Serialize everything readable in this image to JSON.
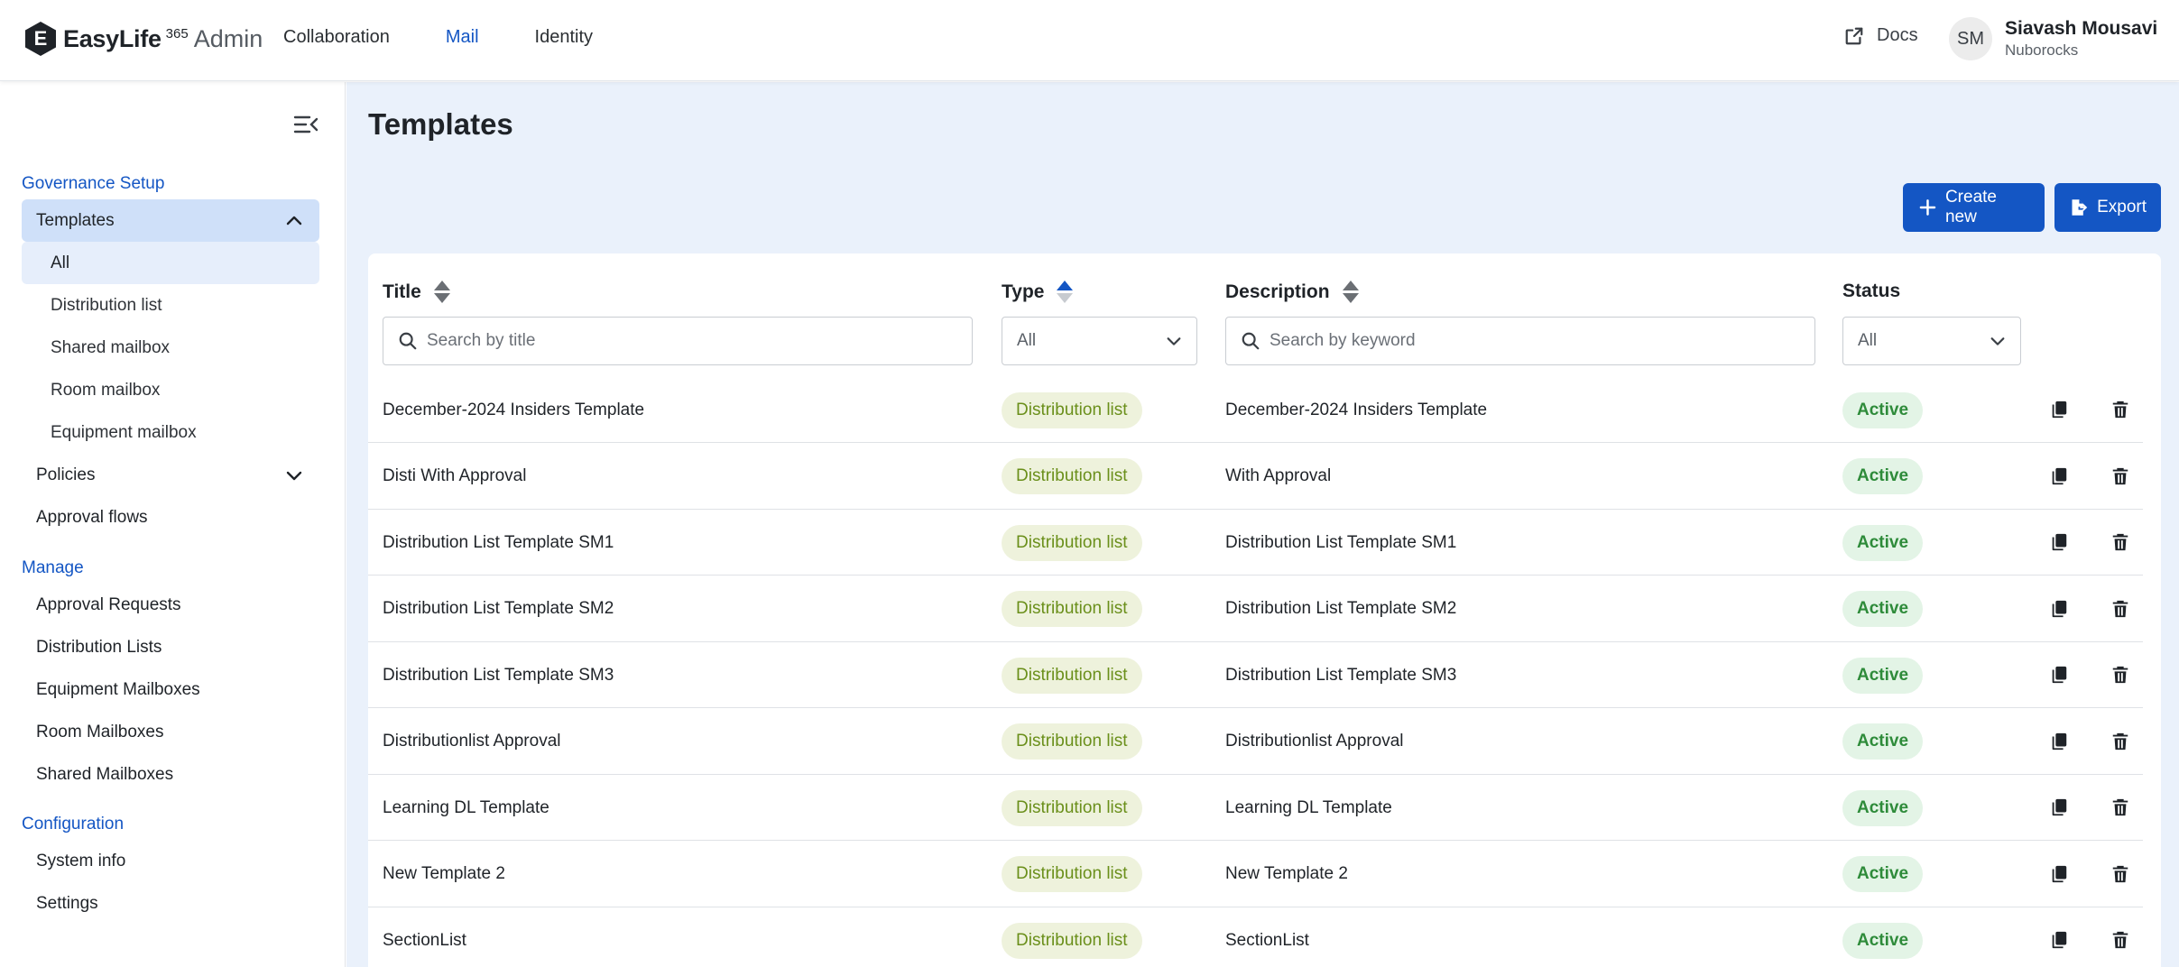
{
  "header": {
    "logo_letter": "E",
    "brand": "EasyLife",
    "brand_superscript": "365",
    "brand_suffix": "Admin",
    "nav": [
      "Collaboration",
      "Mail",
      "Identity"
    ],
    "active_nav": "Mail",
    "docs_label": "Docs",
    "user": {
      "initials": "SM",
      "name": "Siavash Mousavi",
      "org": "Nuborocks"
    }
  },
  "sidebar": {
    "sections": [
      {
        "title": "Governance Setup"
      },
      {
        "title": "Manage"
      },
      {
        "title": "Configuration"
      }
    ],
    "governance": {
      "templates_label": "Templates",
      "template_subitems": [
        "All",
        "Distribution list",
        "Shared mailbox",
        "Room mailbox",
        "Equipment mailbox"
      ],
      "policies_label": "Policies",
      "approval_flows_label": "Approval flows"
    },
    "manage_items": [
      "Approval Requests",
      "Distribution Lists",
      "Equipment Mailboxes",
      "Room Mailboxes",
      "Shared Mailboxes"
    ],
    "configuration_items": [
      "System info",
      "Settings"
    ]
  },
  "page": {
    "title": "Templates",
    "create_label": "Create new",
    "export_label": "Export"
  },
  "table": {
    "columns": {
      "title": "Title",
      "type": "Type",
      "description": "Description",
      "status": "Status"
    },
    "filters": {
      "title_placeholder": "Search by title",
      "type_value": "All",
      "description_placeholder": "Search by keyword",
      "status_value": "All"
    },
    "rows": [
      {
        "title": "December-2024 Insiders Template",
        "type": "Distribution list",
        "description": "December-2024 Insiders Template",
        "status": "Active"
      },
      {
        "title": "Disti With Approval",
        "type": "Distribution list",
        "description": "With Approval",
        "status": "Active"
      },
      {
        "title": "Distribution List Template SM1",
        "type": "Distribution list",
        "description": "Distribution List Template SM1",
        "status": "Active"
      },
      {
        "title": "Distribution List Template SM2",
        "type": "Distribution list",
        "description": "Distribution List Template SM2",
        "status": "Active"
      },
      {
        "title": "Distribution List Template SM3",
        "type": "Distribution list",
        "description": "Distribution List Template SM3",
        "status": "Active"
      },
      {
        "title": "Distributionlist Approval",
        "type": "Distribution list",
        "description": "Distributionlist Approval",
        "status": "Active"
      },
      {
        "title": "Learning DL Template",
        "type": "Distribution list",
        "description": "Learning DL Template",
        "status": "Active"
      },
      {
        "title": "New Template 2",
        "type": "Distribution list",
        "description": "New Template 2",
        "status": "Active"
      },
      {
        "title": "SectionList",
        "type": "Distribution list",
        "description": "SectionList",
        "status": "Active"
      }
    ]
  },
  "colors": {
    "accent": "#1456c4",
    "page_bg": "#eaf1fb",
    "type_pill_bg": "#eef2dc",
    "type_pill_text": "#6a8f1a",
    "status_pill_bg": "#e3f4e6",
    "status_pill_text": "#2e8b3a"
  }
}
